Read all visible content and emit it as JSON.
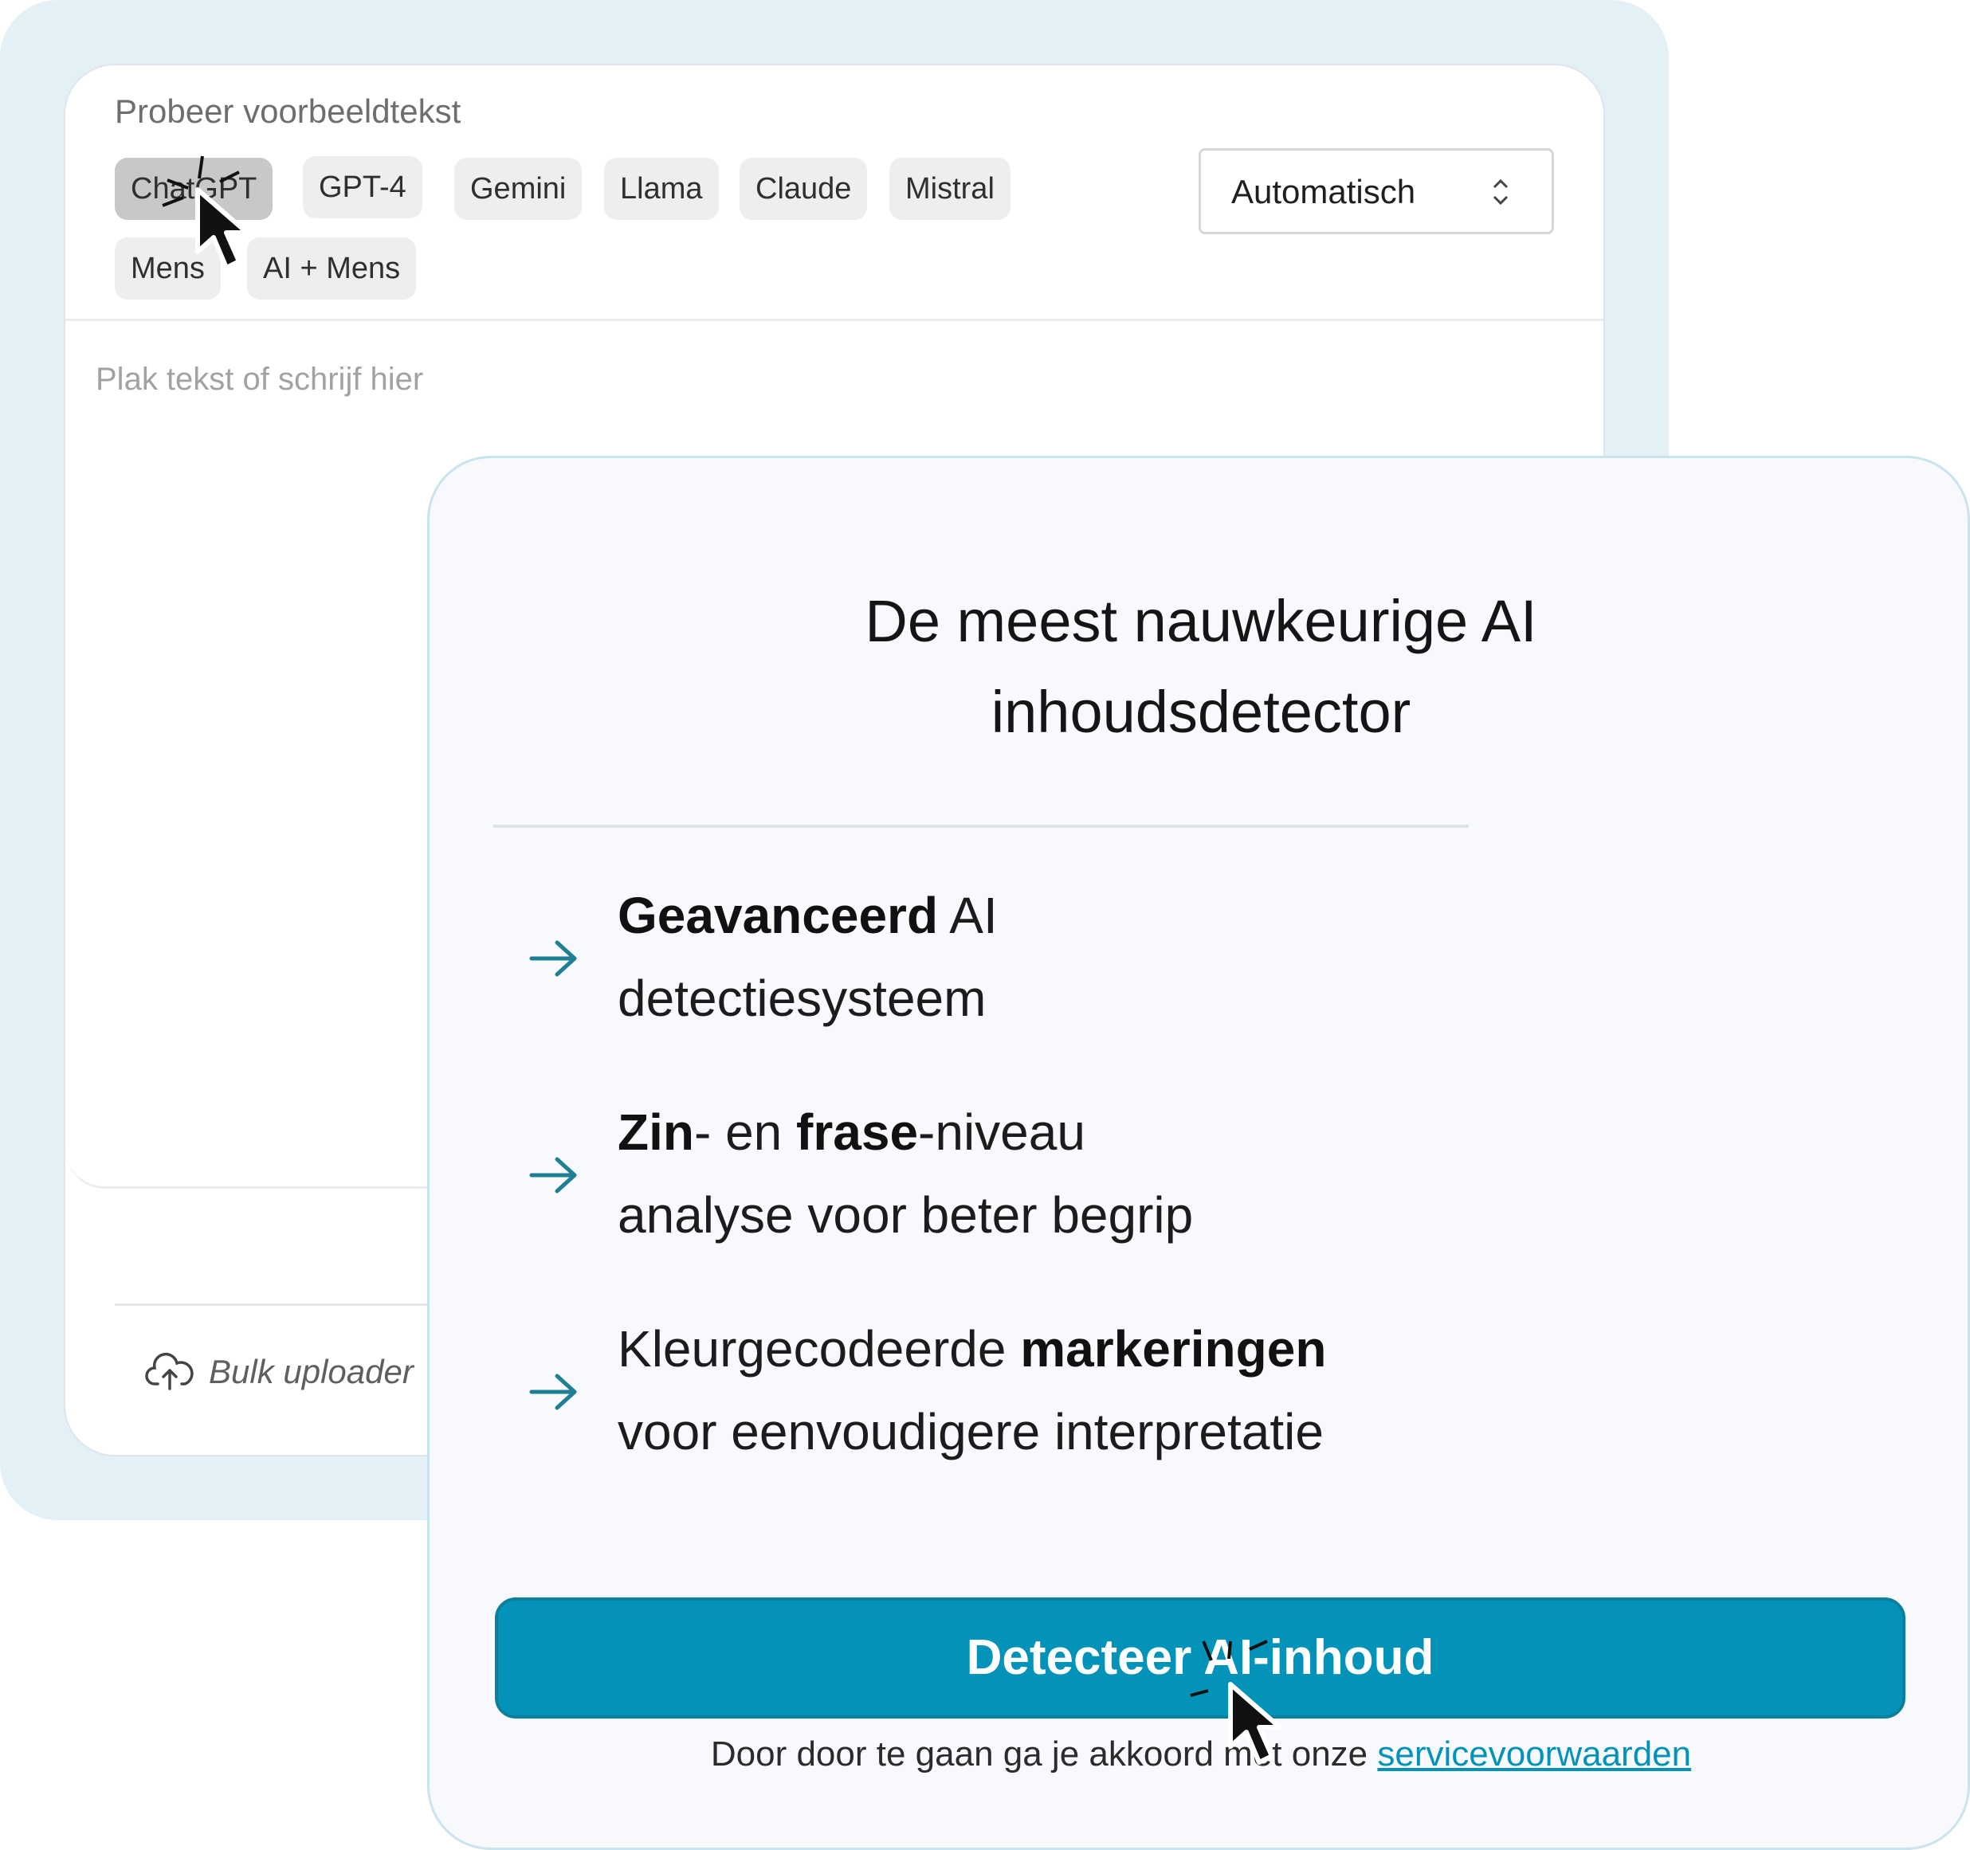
{
  "sample": {
    "label": "Probeer voorbeeldtekst",
    "chips": [
      "ChatGPT",
      "GPT-4",
      "Gemini",
      "Llama",
      "Claude",
      "Mistral",
      "Mens",
      "AI + Mens"
    ],
    "active_chip": "ChatGPT"
  },
  "language_select": {
    "value": "Automatisch"
  },
  "editor": {
    "placeholder": "Plak tekst of schrijf hier"
  },
  "footer": {
    "bulk_label": "Bulk uploader"
  },
  "promo": {
    "headline_line1": "De meest nauwkeurige AI",
    "headline_line2": "inhoudsdetector",
    "features": [
      {
        "bold1": "Geavanceerd",
        "text1": " AI",
        "line2": "detectiesysteem"
      },
      {
        "bold1": "Zin",
        "text1": "- en ",
        "bold2": "frase",
        "text2": "-niveau",
        "line2": "analyse voor beter begrip"
      },
      {
        "text0": "Kleurgecodeerde ",
        "bold1": "markeringen",
        "line2": "voor eenvoudigere interpretatie"
      }
    ],
    "cta_label": "Detecteer AI-inhoud",
    "terms_prefix": "Door door te gaan ga je akkoord met onze ",
    "terms_link": "servicevoorwaarden"
  },
  "colors": {
    "accent": "#0493b8",
    "frame": "#e3f1f7",
    "arrow": "#1f7f95"
  },
  "icons": [
    "cloud-upload-icon",
    "chevron-updown-icon",
    "arrow-right-icon",
    "cursor-icon"
  ]
}
